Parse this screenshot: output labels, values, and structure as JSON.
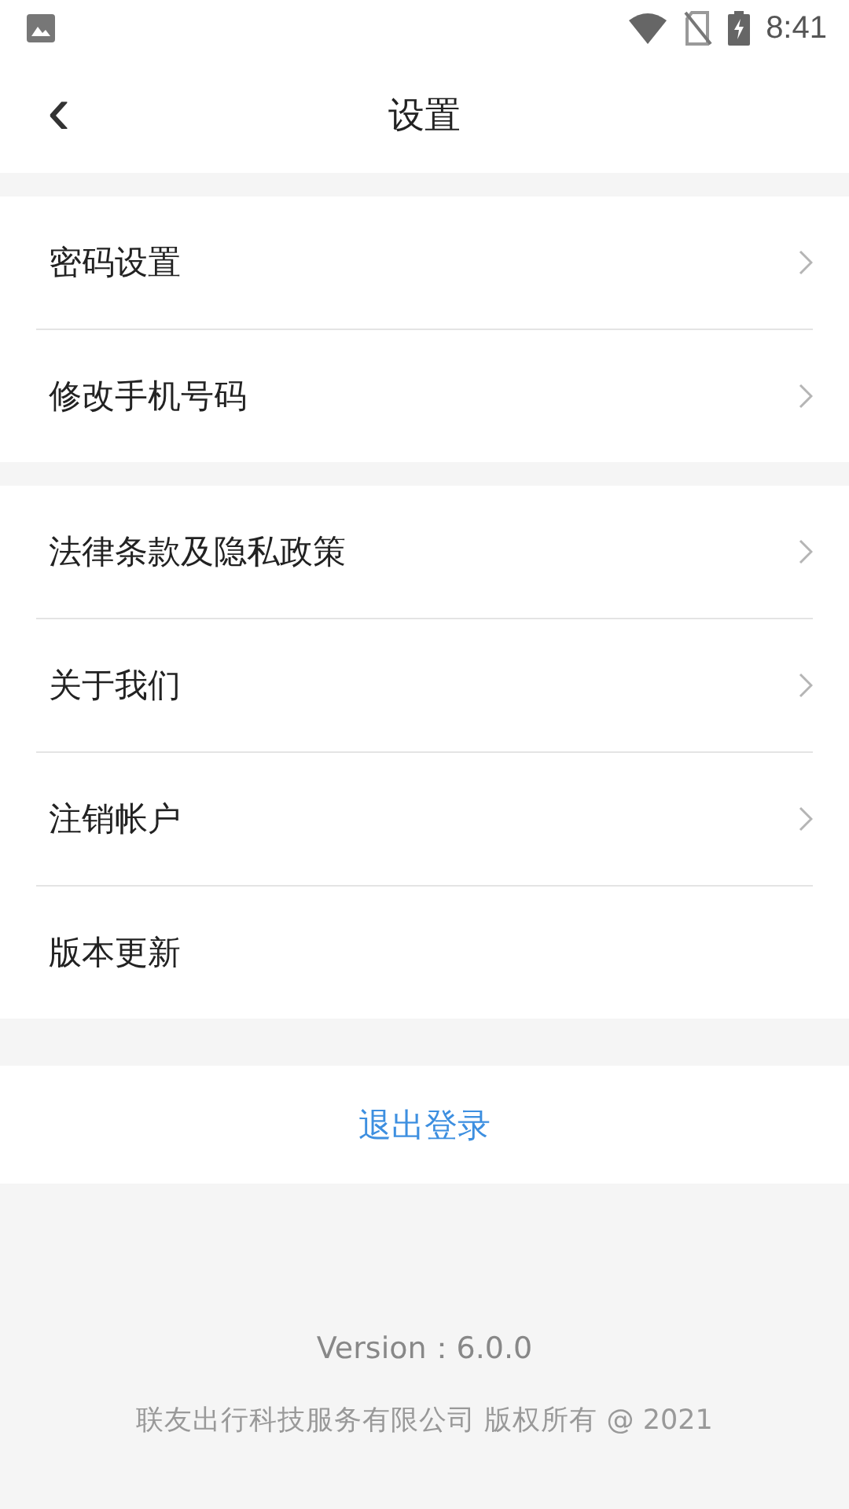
{
  "status_bar": {
    "time": "8:41"
  },
  "header": {
    "back": "‹",
    "title": "设置"
  },
  "groups": [
    {
      "rows": [
        {
          "label": "密码设置",
          "chevron": true
        },
        {
          "label": "修改手机号码",
          "chevron": true
        }
      ]
    },
    {
      "rows": [
        {
          "label": "法律条款及隐私政策",
          "chevron": true
        },
        {
          "label": "关于我们",
          "chevron": true
        },
        {
          "label": "注销帐户",
          "chevron": true
        },
        {
          "label": "版本更新",
          "chevron": false
        }
      ]
    }
  ],
  "logout": "退出登录",
  "footer": {
    "version": "Version：6.0.0",
    "copyright": "联友出行科技服务有限公司 版权所有 @ 2021"
  }
}
